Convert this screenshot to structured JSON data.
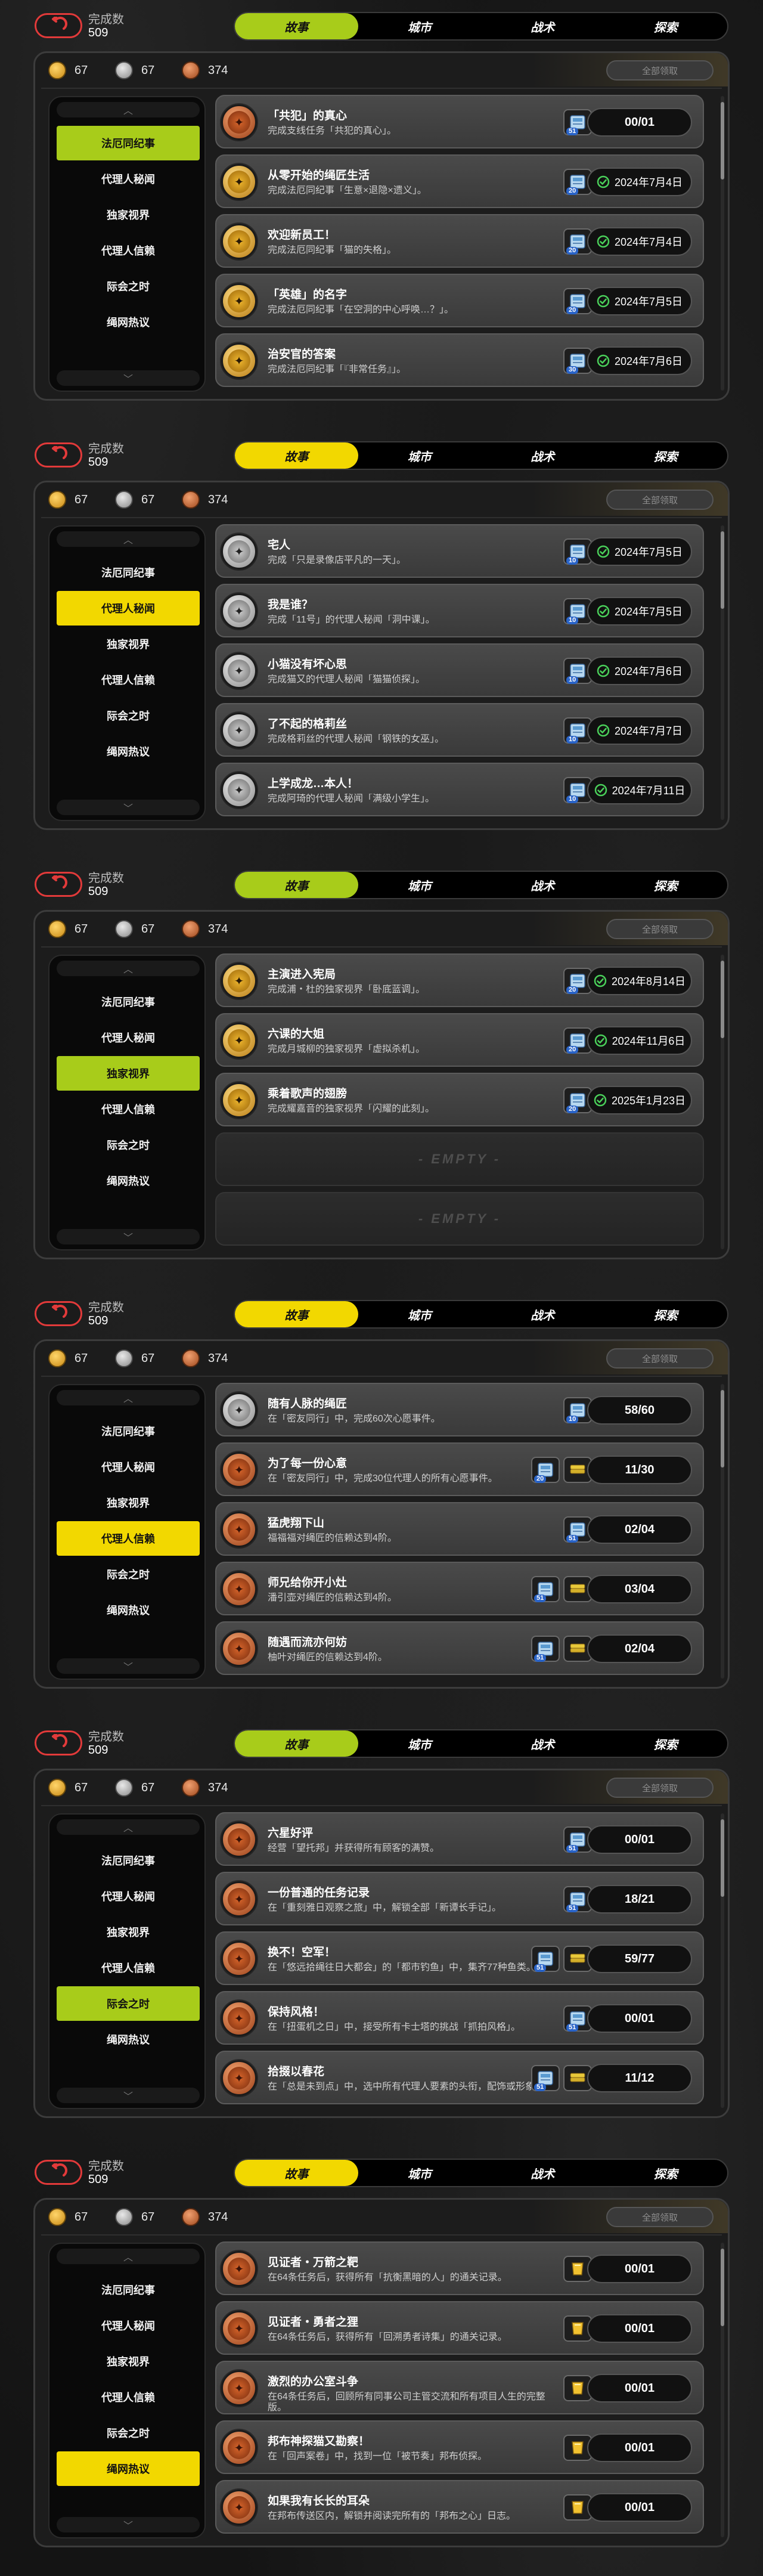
{
  "colors": {
    "accent_green": "#a8cc1a",
    "accent_yellow": "#f2d800",
    "bg": "#141414"
  },
  "panels": [
    {
      "completed_label": "完成数",
      "completed_count": "509",
      "tabs": [
        "故事",
        "城市",
        "战术",
        "探索"
      ],
      "active_tab": 0,
      "tab_color": "#a8cc1a",
      "currency": [
        "67",
        "67",
        "374"
      ],
      "claim_all": "全部领取",
      "sidebar": [
        "法厄同纪事",
        "代理人秘闻",
        "独家视界",
        "代理人信赖",
        "际会之时",
        "绳网热议"
      ],
      "active_side": 0,
      "tasks": [
        {
          "medal": "bronze",
          "title": "「共犯」的真心",
          "desc": "完成支线任务「共犯的真心」。",
          "rewards": [
            {
              "icon": "ticket",
              "count": "51"
            }
          ],
          "status": "00/01",
          "done": false
        },
        {
          "medal": "gold",
          "title": "从零开始的绳匠生活",
          "desc": "完成法厄同纪事「生意×退隐×遗义」。",
          "rewards": [
            {
              "icon": "ticket",
              "count": "20"
            }
          ],
          "status": "2024年7月4日",
          "done": true
        },
        {
          "medal": "gold",
          "title": "欢迎新员工！",
          "desc": "完成法厄同纪事「猫的失格」。",
          "rewards": [
            {
              "icon": "ticket",
              "count": "20"
            }
          ],
          "status": "2024年7月4日",
          "done": true
        },
        {
          "medal": "gold",
          "title": "「英雄」的名字",
          "desc": "完成法厄同纪事「在空洞的中心呼唤…？」。",
          "rewards": [
            {
              "icon": "ticket",
              "count": "20"
            }
          ],
          "status": "2024年7月5日",
          "done": true
        },
        {
          "medal": "gold",
          "title": "治安官的答案",
          "desc": "完成法厄同纪事「『非常任务』」。",
          "rewards": [
            {
              "icon": "ticket",
              "count": "30"
            }
          ],
          "status": "2024年7月6日",
          "done": true
        }
      ]
    },
    {
      "completed_label": "完成数",
      "completed_count": "509",
      "tabs": [
        "故事",
        "城市",
        "战术",
        "探索"
      ],
      "active_tab": 0,
      "tab_color": "#f2d800",
      "currency": [
        "67",
        "67",
        "374"
      ],
      "claim_all": "全部领取",
      "sidebar": [
        "法厄同纪事",
        "代理人秘闻",
        "独家视界",
        "代理人信赖",
        "际会之时",
        "绳网热议"
      ],
      "active_side": 1,
      "tasks": [
        {
          "medal": "silver",
          "title": "宅人",
          "desc": "完成「只是录像店平凡的一天」。",
          "rewards": [
            {
              "icon": "ticket",
              "count": "10"
            }
          ],
          "status": "2024年7月5日",
          "done": true
        },
        {
          "medal": "silver",
          "title": "我是谁？",
          "desc": "完成「11号」的代理人秘闻「洞中课」。",
          "rewards": [
            {
              "icon": "ticket",
              "count": "10"
            }
          ],
          "status": "2024年7月5日",
          "done": true
        },
        {
          "medal": "silver",
          "title": "小猫没有坏心思",
          "desc": "完成猫又的代理人秘闻「猫猫侦探」。",
          "rewards": [
            {
              "icon": "ticket",
              "count": "10"
            }
          ],
          "status": "2024年7月6日",
          "done": true
        },
        {
          "medal": "silver",
          "title": "了不起的格莉丝",
          "desc": "完成格莉丝的代理人秘闻「钢铁的女巫」。",
          "rewards": [
            {
              "icon": "ticket",
              "count": "10"
            }
          ],
          "status": "2024年7月7日",
          "done": true
        },
        {
          "medal": "silver",
          "title": "上学成龙…本人！",
          "desc": "完成阿琦的代理人秘闻「满级小学生」。",
          "rewards": [
            {
              "icon": "ticket",
              "count": "10"
            }
          ],
          "status": "2024年7月11日",
          "done": true
        }
      ]
    },
    {
      "completed_label": "完成数",
      "completed_count": "509",
      "tabs": [
        "故事",
        "城市",
        "战术",
        "探索"
      ],
      "active_tab": 0,
      "tab_color": "#a8cc1a",
      "currency": [
        "67",
        "67",
        "374"
      ],
      "claim_all": "全部领取",
      "sidebar": [
        "法厄同纪事",
        "代理人秘闻",
        "独家视界",
        "代理人信赖",
        "际会之时",
        "绳网热议"
      ],
      "active_side": 2,
      "tasks": [
        {
          "medal": "gold",
          "title": "主演进入宪局",
          "desc": "完成浦・杜的独家视界「卧底蓝调」。",
          "rewards": [
            {
              "icon": "ticket",
              "count": "20"
            }
          ],
          "status": "2024年8月14日",
          "done": true
        },
        {
          "medal": "gold",
          "title": "六课的大姐",
          "desc": "完成月城柳的独家视界「虚拟杀机」。",
          "rewards": [
            {
              "icon": "ticket",
              "count": "20"
            }
          ],
          "status": "2024年11月6日",
          "done": true
        },
        {
          "medal": "gold",
          "title": "乘着歌声的翅膀",
          "desc": "完成耀嘉音的独家视界「闪耀的此刻」。",
          "rewards": [
            {
              "icon": "ticket",
              "count": "20"
            }
          ],
          "status": "2025年1月23日",
          "done": true
        },
        {
          "empty": true,
          "label": "- EMPTY -"
        },
        {
          "empty": true,
          "label": "- EMPTY -"
        }
      ]
    },
    {
      "completed_label": "完成数",
      "completed_count": "509",
      "tabs": [
        "故事",
        "城市",
        "战术",
        "探索"
      ],
      "active_tab": 0,
      "tab_color": "#f2d800",
      "currency": [
        "67",
        "67",
        "374"
      ],
      "claim_all": "全部领取",
      "sidebar": [
        "法厄同纪事",
        "代理人秘闻",
        "独家视界",
        "代理人信赖",
        "际会之时",
        "绳网热议"
      ],
      "active_side": 3,
      "tasks": [
        {
          "medal": "silver",
          "title": "随有人脉的绳匠",
          "desc": "在「密友同行」中，完成60次心愿事件。",
          "rewards": [
            {
              "icon": "ticket",
              "count": "10"
            }
          ],
          "status": "58/60",
          "done": false
        },
        {
          "medal": "bronze",
          "title": "为了每一份心意",
          "desc": "在「密友同行」中，完成30位代理人的所有心愿事件。",
          "rewards": [
            {
              "icon": "ticket",
              "count": "20"
            },
            {
              "icon": "stack",
              "count": ""
            }
          ],
          "status": "11/30",
          "done": false
        },
        {
          "medal": "bronze",
          "title": "猛虎翔下山",
          "desc": "福福福对绳匠的信赖达到4阶。",
          "rewards": [
            {
              "icon": "ticket",
              "count": "51"
            }
          ],
          "status": "02/04",
          "done": false
        },
        {
          "medal": "bronze",
          "title": "师兄给你开小灶",
          "desc": "潘引壶对绳匠的信赖达到4阶。",
          "rewards": [
            {
              "icon": "ticket",
              "count": "51"
            },
            {
              "icon": "stack",
              "count": ""
            }
          ],
          "status": "03/04",
          "done": false
        },
        {
          "medal": "bronze",
          "title": "随遇而流亦何妨",
          "desc": "柚叶对绳匠的信赖达到4阶。",
          "rewards": [
            {
              "icon": "ticket",
              "count": "51"
            },
            {
              "icon": "stack",
              "count": ""
            }
          ],
          "status": "02/04",
          "done": false
        }
      ]
    },
    {
      "completed_label": "完成数",
      "completed_count": "509",
      "tabs": [
        "故事",
        "城市",
        "战术",
        "探索"
      ],
      "active_tab": 0,
      "tab_color": "#a8cc1a",
      "currency": [
        "67",
        "67",
        "374"
      ],
      "claim_all": "全部领取",
      "sidebar": [
        "法厄同纪事",
        "代理人秘闻",
        "独家视界",
        "代理人信赖",
        "际会之时",
        "绳网热议"
      ],
      "active_side": 4,
      "tasks": [
        {
          "medal": "bronze",
          "title": "六星好评",
          "desc": "经营「望托邦」并获得所有顾客的满赞。",
          "rewards": [
            {
              "icon": "ticket",
              "count": "51"
            }
          ],
          "status": "00/01",
          "done": false
        },
        {
          "medal": "bronze",
          "title": "一份普通的任务记录",
          "desc": "在「重刻雅日观察之旅」中，解锁全部「新谭长手记」。",
          "rewards": [
            {
              "icon": "ticket",
              "count": "51"
            }
          ],
          "status": "18/21",
          "done": false
        },
        {
          "medal": "bronze",
          "title": "换不！空军！",
          "desc": "在「悠远拾绳往日大都会」的「都市钓鱼」中，集齐77种鱼类。",
          "rewards": [
            {
              "icon": "ticket",
              "count": "51"
            },
            {
              "icon": "stack",
              "count": ""
            }
          ],
          "status": "59/77",
          "done": false
        },
        {
          "medal": "bronze",
          "title": "保持风格！",
          "desc": "在「扭蛋机之日」中，接受所有卡士塔的挑战「抓拍风格」。",
          "rewards": [
            {
              "icon": "ticket",
              "count": "51"
            }
          ],
          "status": "00/01",
          "done": false
        },
        {
          "medal": "bronze",
          "title": "拾掇以春花",
          "desc": "在「总是未到点」中，选中所有代理人要素的头衔，配饰或形象。",
          "rewards": [
            {
              "icon": "ticket",
              "count": "51"
            },
            {
              "icon": "stack",
              "count": ""
            }
          ],
          "status": "11/12",
          "done": false
        }
      ]
    },
    {
      "completed_label": "完成数",
      "completed_count": "509",
      "tabs": [
        "故事",
        "城市",
        "战术",
        "探索"
      ],
      "active_tab": 0,
      "tab_color": "#f2d800",
      "currency": [
        "67",
        "67",
        "374"
      ],
      "claim_all": "全部领取",
      "sidebar": [
        "法厄同纪事",
        "代理人秘闻",
        "独家视界",
        "代理人信赖",
        "际会之时",
        "绳网热议"
      ],
      "active_side": 5,
      "tasks": [
        {
          "medal": "bronze",
          "title": "见证者・万箭之靶",
          "desc": "在64条任务后，获得所有「抗衡黑暗的人」的通关记录。",
          "rewards": [
            {
              "icon": "gold",
              "count": ""
            }
          ],
          "status": "00/01",
          "done": false
        },
        {
          "medal": "bronze",
          "title": "见证者・勇者之狸",
          "desc": "在64条任务后，获得所有「回溯勇者诗集」的通关记录。",
          "rewards": [
            {
              "icon": "gold",
              "count": ""
            }
          ],
          "status": "00/01",
          "done": false
        },
        {
          "medal": "bronze",
          "title": "激烈的办公室斗争",
          "desc": "在64条任务后，回顾所有同事公司主管交流和所有项目人生的完整版。",
          "rewards": [
            {
              "icon": "gold",
              "count": ""
            }
          ],
          "status": "00/01",
          "done": false
        },
        {
          "medal": "bronze",
          "title": "邦布神探猫又勘察！",
          "desc": "在「回声案卷」中，找到一位「被节奏」邦布侦探。",
          "rewards": [
            {
              "icon": "gold",
              "count": ""
            }
          ],
          "status": "00/01",
          "done": false
        },
        {
          "medal": "bronze",
          "title": "如果我有长长的耳朵",
          "desc": "在邦布传送区内，解锁并阅读完所有的「邦布之心」日志。",
          "rewards": [
            {
              "icon": "gold",
              "count": ""
            }
          ],
          "status": "00/01",
          "done": false
        }
      ]
    }
  ]
}
